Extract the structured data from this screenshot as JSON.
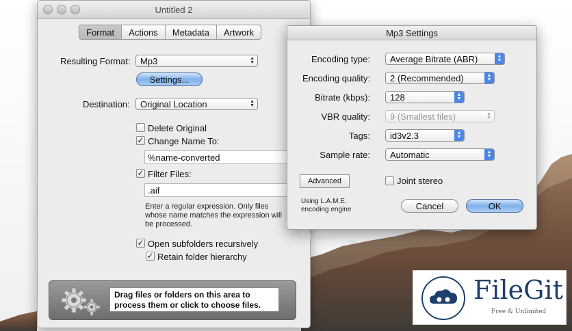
{
  "window": {
    "title": "Untitled 2"
  },
  "tabs": [
    "Format",
    "Actions",
    "Metadata",
    "Artwork"
  ],
  "format": {
    "resulting_format_label": "Resulting Format:",
    "resulting_format_value": "Mp3",
    "settings_button": "Settings...",
    "destination_label": "Destination:",
    "destination_value": "Original Location",
    "delete_original": {
      "label": "Delete Original",
      "checked": false
    },
    "change_name": {
      "label": "Change Name To:",
      "checked": true,
      "value": "%name-converted"
    },
    "filter_files": {
      "label": "Filter Files:",
      "checked": true,
      "value": ".aif"
    },
    "filter_hint": [
      "Enter a regular expression. Only files",
      "whose name matches the expression will",
      "be processed."
    ],
    "open_subfolders": {
      "label": "Open subfolders recursively",
      "checked": true
    },
    "retain_hierarchy": {
      "label": "Retain folder hierarchy",
      "checked": true
    }
  },
  "dropzone": {
    "message_line1": "Drag files or folders on this area to",
    "message_line2": "process them or click to choose files."
  },
  "settings": {
    "title": "Mp3 Settings",
    "encoding_type": {
      "label": "Encoding type:",
      "value": "Average Bitrate (ABR)"
    },
    "encoding_quality": {
      "label": "Encoding quality:",
      "value": "2 (Recommended)"
    },
    "bitrate": {
      "label": "Bitrate (kbps):",
      "value": "128"
    },
    "vbr_quality": {
      "label": "VBR quality:",
      "value": "9 (Smallest files)"
    },
    "tags": {
      "label": "Tags:",
      "value": "id3v2.3"
    },
    "sample_rate": {
      "label": "Sample rate:",
      "value": "Automatic"
    },
    "advanced_button": "Advanced",
    "joint_stereo": {
      "label": "Joint stereo",
      "checked": false
    },
    "engine_note_line1": "Using L.A.M.E.",
    "engine_note_line2": "encoding engine",
    "cancel_button": "Cancel",
    "ok_button": "OK"
  },
  "watermark": {
    "text": "FILECR",
    "sub": ".com"
  },
  "badge": {
    "brand": "FileGit",
    "tagline": "Free & Unlimited"
  }
}
